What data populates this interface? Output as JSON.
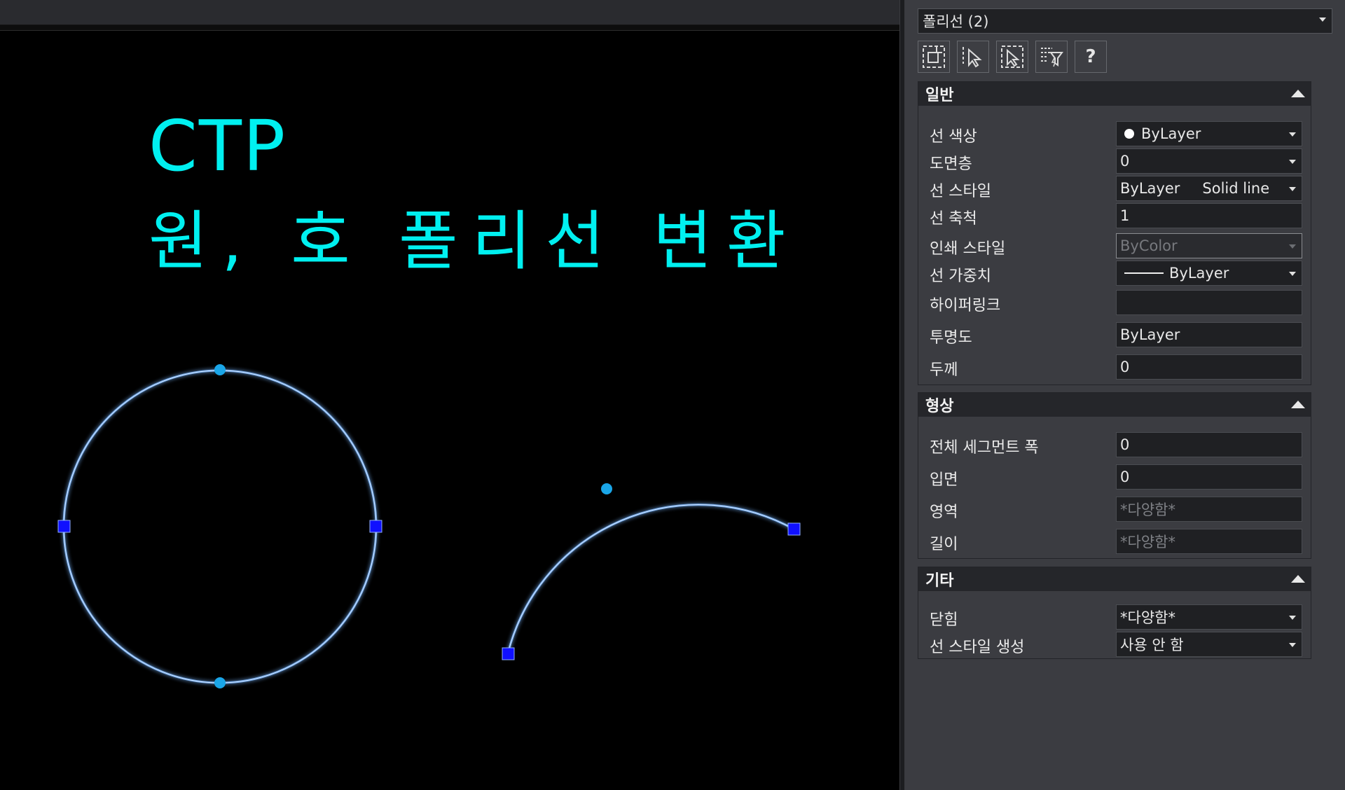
{
  "drawing": {
    "title_line1": "CTP",
    "title_line2": "원, 호 폴리선 변환",
    "text_color": "#00f0f0",
    "curve_color": "#6fa6e6",
    "grip_square_color": "#1010ff",
    "grip_dot_color": "#1aa6e8"
  },
  "palette": {
    "object_selector": "폴리선 (2)",
    "toolbar": {
      "icons": [
        "toggle-pickadd-icon",
        "select-objects-icon",
        "quick-select-icon",
        "filter-icon",
        "help-icon"
      ],
      "help_label": "?"
    },
    "sections": {
      "general": {
        "title": "일반",
        "rows": [
          {
            "label": "선 색상",
            "value": "ByLayer"
          },
          {
            "label": "도면층",
            "value": "0"
          },
          {
            "label": "선 스타일",
            "value": "ByLayer",
            "value2": "Solid line"
          },
          {
            "label": "선 축척",
            "value": "1"
          },
          {
            "label": "인쇄 스타일",
            "value": "ByColor"
          },
          {
            "label": "선 가중치",
            "value": "ByLayer"
          },
          {
            "label": "하이퍼링크",
            "value": ""
          },
          {
            "label": "투명도",
            "value": "ByLayer"
          },
          {
            "label": "두께",
            "value": "0"
          }
        ]
      },
      "geometry": {
        "title": "형상",
        "rows": [
          {
            "label": "전체 세그먼트 폭",
            "value": "0"
          },
          {
            "label": "입면",
            "value": "0"
          },
          {
            "label": "영역",
            "value": "*다양함*"
          },
          {
            "label": "길이",
            "value": "*다양함*"
          }
        ]
      },
      "misc": {
        "title": "기타",
        "rows": [
          {
            "label": "닫힘",
            "value": "*다양함*"
          },
          {
            "label": "선 스타일 생성",
            "value": "사용 안 함"
          }
        ]
      }
    }
  }
}
